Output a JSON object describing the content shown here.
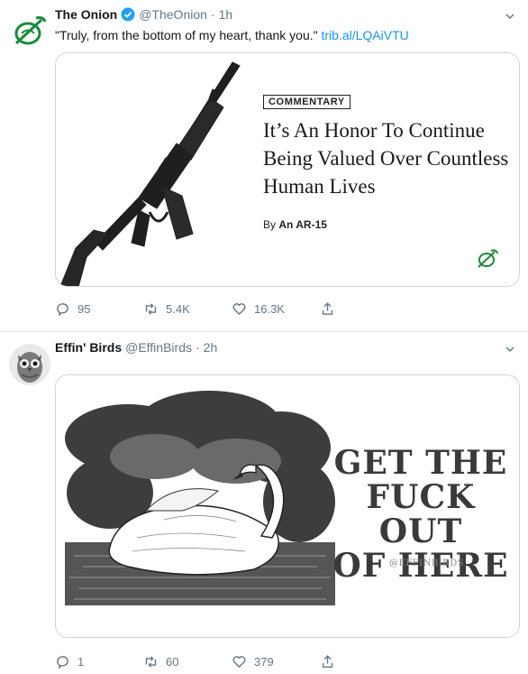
{
  "tweets": [
    {
      "author": "The Onion",
      "verified": true,
      "handle": "@TheOnion",
      "separator": "·",
      "time": "1h",
      "text": "\"Truly, from the bottom of my heart, thank you.\"",
      "link": "trib.al/LQAiVTU",
      "card": {
        "tag": "COMMENTARY",
        "headline": "It’s An Honor To Continue Being Valued Over Countless Human Lives",
        "byline_prefix": "By",
        "byline_author": "An AR-15"
      },
      "actions": {
        "replies": "95",
        "retweets": "5.4K",
        "likes": "16.3K"
      }
    },
    {
      "author": "Effin' Birds",
      "handle": "@EffinBirds",
      "separator": "·",
      "time": "2h",
      "card": {
        "poster_line1": "GET THE",
        "poster_line2": "FUCK OUT",
        "poster_line3": "OF HERE",
        "watermark": "@EFFINBIRDS"
      },
      "actions": {
        "replies": "1",
        "retweets": "60",
        "likes": "379"
      }
    }
  ],
  "colors": {
    "onion_green": "#1a8a3c",
    "link_blue": "#1b95e0",
    "muted": "#657786",
    "border": "#ccd6dd"
  },
  "icons": [
    "onion-logo-icon",
    "verified-icon",
    "chevron-down-icon",
    "reply-icon",
    "retweet-icon",
    "like-icon",
    "share-icon",
    "owl-avatar"
  ]
}
